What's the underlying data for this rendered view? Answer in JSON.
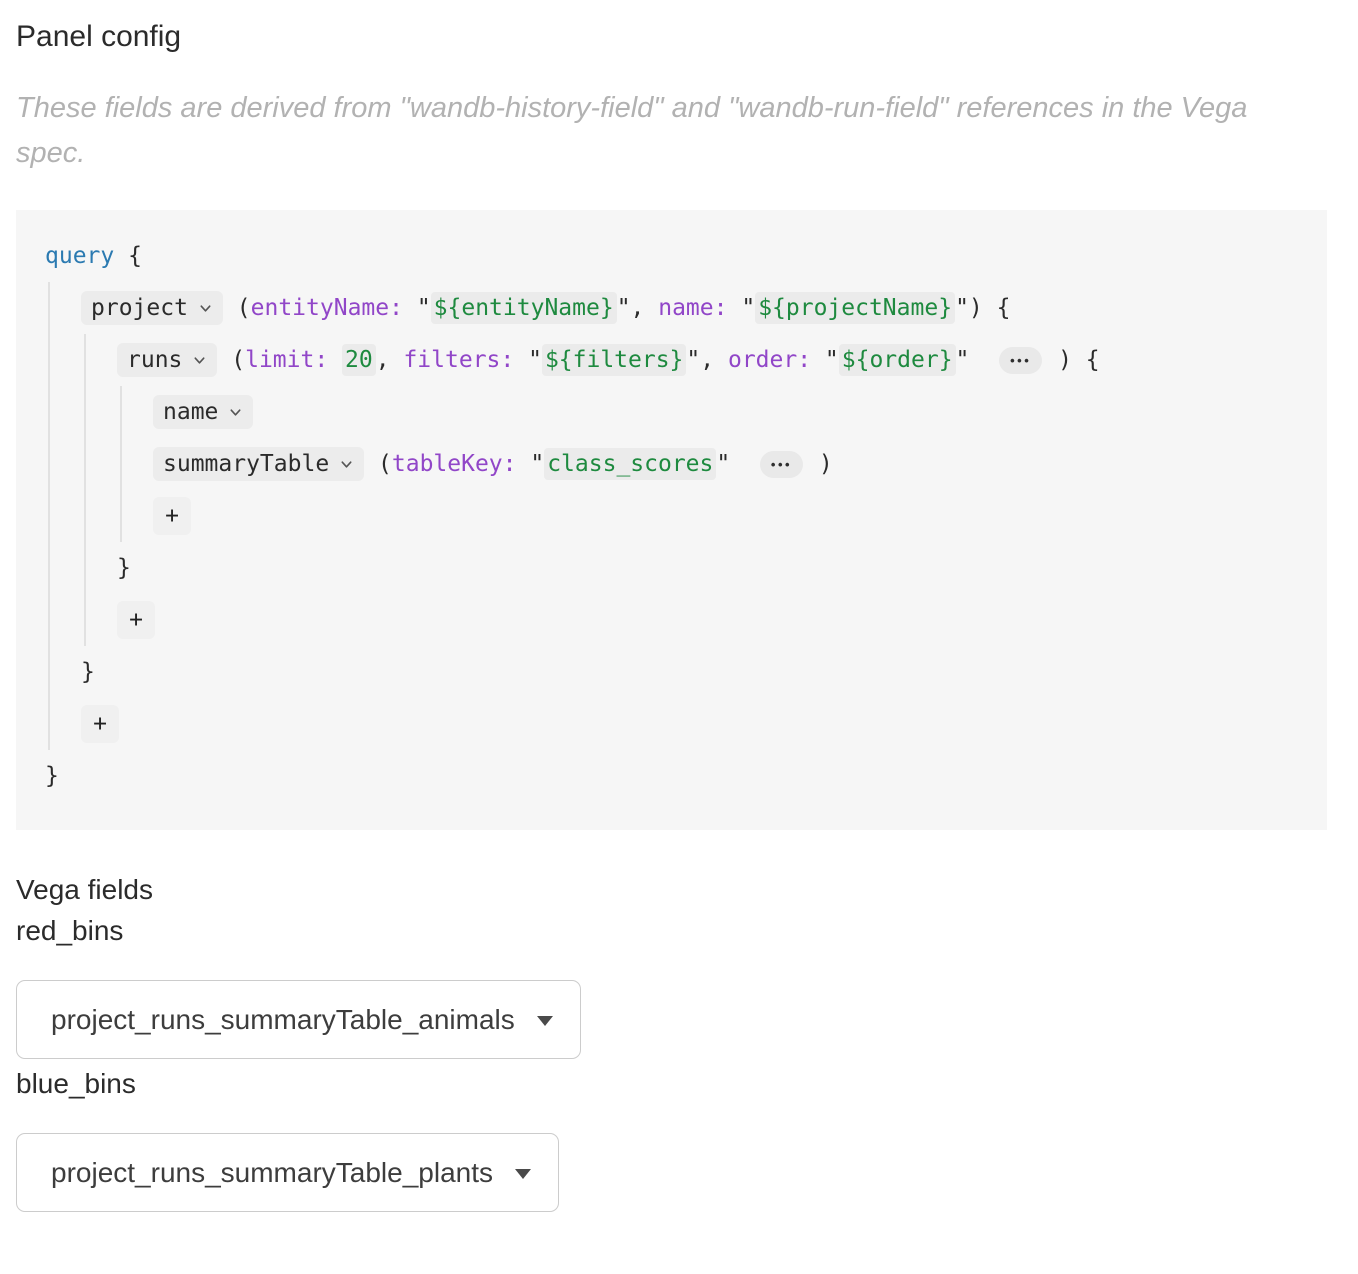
{
  "header": {
    "title": "Panel config",
    "description": "These fields are derived from \"wandb-history-field\" and \"wandb-run-field\" references in the Vega spec."
  },
  "colors": {
    "keyword_blue": "#2b7ab1",
    "argument_purple": "#9146c8",
    "value_green": "#1e8a3f",
    "code_background": "#f6f6f6"
  },
  "query_editor": {
    "root": {
      "tokens": [
        {
          "t": "kw",
          "v": "query"
        },
        {
          "t": "pl",
          "v": " {"
        }
      ],
      "children": [
        {
          "tokens": [
            {
              "t": "chip",
              "v": "project"
            },
            {
              "t": "pl",
              "v": " ("
            },
            {
              "t": "arg",
              "v": "entityName:"
            },
            {
              "t": "pl",
              "v": " \""
            },
            {
              "t": "tpl",
              "v": "${entityName}"
            },
            {
              "t": "pl",
              "v": "\", "
            },
            {
              "t": "arg",
              "v": "name:"
            },
            {
              "t": "pl",
              "v": " \""
            },
            {
              "t": "tpl",
              "v": "${projectName}"
            },
            {
              "t": "pl",
              "v": "\") {"
            }
          ],
          "children": [
            {
              "tokens": [
                {
                  "t": "chip",
                  "v": "runs"
                },
                {
                  "t": "pl",
                  "v": " ("
                },
                {
                  "t": "arg",
                  "v": "limit:"
                },
                {
                  "t": "pl",
                  "v": " "
                },
                {
                  "t": "num",
                  "v": "20"
                },
                {
                  "t": "pl",
                  "v": ", "
                },
                {
                  "t": "arg",
                  "v": "filters:"
                },
                {
                  "t": "pl",
                  "v": " \""
                },
                {
                  "t": "tpl",
                  "v": "${filters}"
                },
                {
                  "t": "pl",
                  "v": "\", "
                },
                {
                  "t": "arg",
                  "v": "order:"
                },
                {
                  "t": "pl",
                  "v": " \""
                },
                {
                  "t": "tpl",
                  "v": "${order}"
                },
                {
                  "t": "pl",
                  "v": "\"  "
                },
                {
                  "t": "dots",
                  "v": "•••"
                },
                {
                  "t": "pl",
                  "v": " ) {"
                }
              ],
              "children": [
                {
                  "tokens": [
                    {
                      "t": "chip",
                      "v": "name"
                    }
                  ]
                },
                {
                  "tokens": [
                    {
                      "t": "chip",
                      "v": "summaryTable"
                    },
                    {
                      "t": "pl",
                      "v": " ("
                    },
                    {
                      "t": "arg",
                      "v": "tableKey:"
                    },
                    {
                      "t": "pl",
                      "v": " \""
                    },
                    {
                      "t": "tpl",
                      "v": "class_scores"
                    },
                    {
                      "t": "pl",
                      "v": "\"  "
                    },
                    {
                      "t": "dots",
                      "v": "•••"
                    },
                    {
                      "t": "pl",
                      "v": " )"
                    }
                  ]
                },
                {
                  "add_button": "+"
                }
              ],
              "close": "}"
            },
            {
              "add_button": "+"
            }
          ],
          "close": "}"
        },
        {
          "add_button": "+"
        }
      ],
      "close": "}"
    }
  },
  "vega_fields": {
    "title": "Vega fields",
    "fields": [
      {
        "label": "red_bins",
        "selected": "project_runs_summaryTable_animals"
      },
      {
        "label": "blue_bins",
        "selected": "project_runs_summaryTable_plants"
      }
    ]
  }
}
